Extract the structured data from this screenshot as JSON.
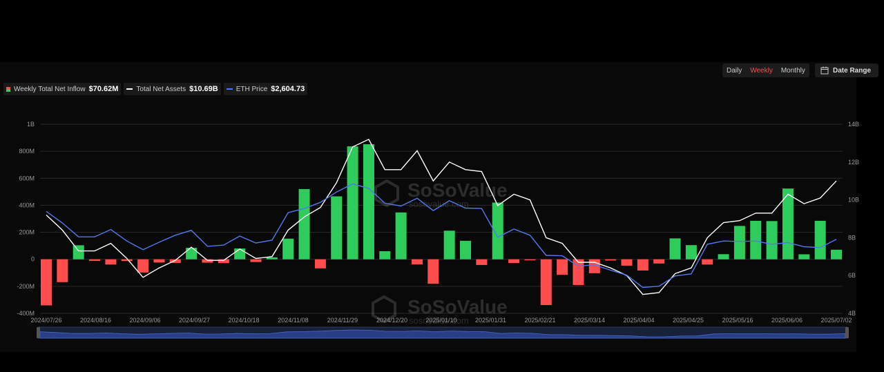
{
  "controls": {
    "period_options": [
      "Daily",
      "Weekly",
      "Monthly"
    ],
    "active_period": "Weekly",
    "date_range_label": "Date Range"
  },
  "legend": [
    {
      "label": "Weekly Total Net Inflow",
      "value": "$70.62M",
      "color": "#2ecc5b"
    },
    {
      "label": "Total Net Assets",
      "value": "$10.69B",
      "color": "#ffffff"
    },
    {
      "label": "ETH Price",
      "value": "$2,604.73",
      "color": "#5577ee"
    }
  ],
  "watermark": {
    "brand": "SoSoValue",
    "url": "sosovalue.com"
  },
  "chart_data": {
    "type": "bar",
    "x_labels": [
      "2024/07/26",
      "2024/08/16",
      "2024/09/06",
      "2024/09/27",
      "2024/10/18",
      "2024/11/08",
      "2024/11/29",
      "2024/12/20",
      "2025/01/10",
      "2025/01/31",
      "2025/02/21",
      "2025/03/14",
      "2025/04/04",
      "2025/04/25",
      "2025/05/16",
      "2025/06/06",
      "2025/07/02"
    ],
    "left_axis": {
      "ticks": [
        "1B",
        "800M",
        "600M",
        "400M",
        "200M",
        "0",
        "-200M",
        "-400M"
      ],
      "range": [
        -400,
        1000
      ],
      "unit": "M"
    },
    "right_axis": {
      "ticks": [
        "14B",
        "12B",
        "10B",
        "8B",
        "6B",
        "4B"
      ],
      "range": [
        4,
        14
      ],
      "unit": "B"
    },
    "grid": true,
    "series": [
      {
        "name": "Weekly Total Net Inflow",
        "kind": "bar",
        "unit": "M",
        "positive_color": "#2ecc5b",
        "negative_color": "#ff4d4d",
        "values": [
          -341,
          -169,
          104,
          -12,
          -39,
          -13,
          -98,
          -24,
          -27,
          85,
          -25,
          -28,
          80,
          -20,
          14,
          153,
          520,
          -67,
          466,
          836,
          852,
          60,
          347,
          -38,
          -181,
          212,
          137,
          -42,
          420,
          -27,
          -2,
          -339,
          -115,
          -190,
          -103,
          -9,
          -47,
          -83,
          -31,
          155,
          105,
          -39,
          38,
          247,
          285,
          283,
          524,
          37,
          285,
          71
        ]
      },
      {
        "name": "Total Net Assets",
        "kind": "line",
        "unit": "B",
        "color": "#ffffff",
        "values": [
          9.2,
          8.4,
          7.3,
          7.3,
          7.7,
          6.9,
          5.9,
          6.4,
          6.8,
          7.5,
          6.8,
          6.8,
          7.4,
          6.9,
          7.0,
          8.4,
          9.1,
          9.6,
          10.9,
          12.8,
          13.2,
          11.6,
          11.6,
          12.6,
          11.0,
          12.0,
          11.6,
          11.5,
          9.7,
          10.3,
          10.0,
          8.0,
          7.7,
          6.7,
          6.7,
          6.4,
          6.0,
          5.0,
          5.1,
          6.1,
          6.4,
          8.0,
          8.8,
          8.9,
          9.3,
          9.3,
          10.3,
          9.8,
          10.1,
          11.0
        ]
      },
      {
        "name": "ETH Price",
        "kind": "line",
        "unit": "USD",
        "color": "#5577ee",
        "values": [
          3280,
          3000,
          2660,
          2660,
          2840,
          2560,
          2350,
          2530,
          2700,
          2820,
          2430,
          2460,
          2680,
          2510,
          2580,
          3250,
          3350,
          3500,
          3750,
          3950,
          3840,
          3480,
          3410,
          3600,
          3300,
          3540,
          3360,
          3350,
          2650,
          2850,
          2700,
          2210,
          2200,
          1950,
          1980,
          1850,
          1730,
          1430,
          1460,
          1710,
          1760,
          2480,
          2560,
          2550,
          2560,
          2480,
          2520,
          2420,
          2400,
          2600
        ]
      }
    ]
  }
}
